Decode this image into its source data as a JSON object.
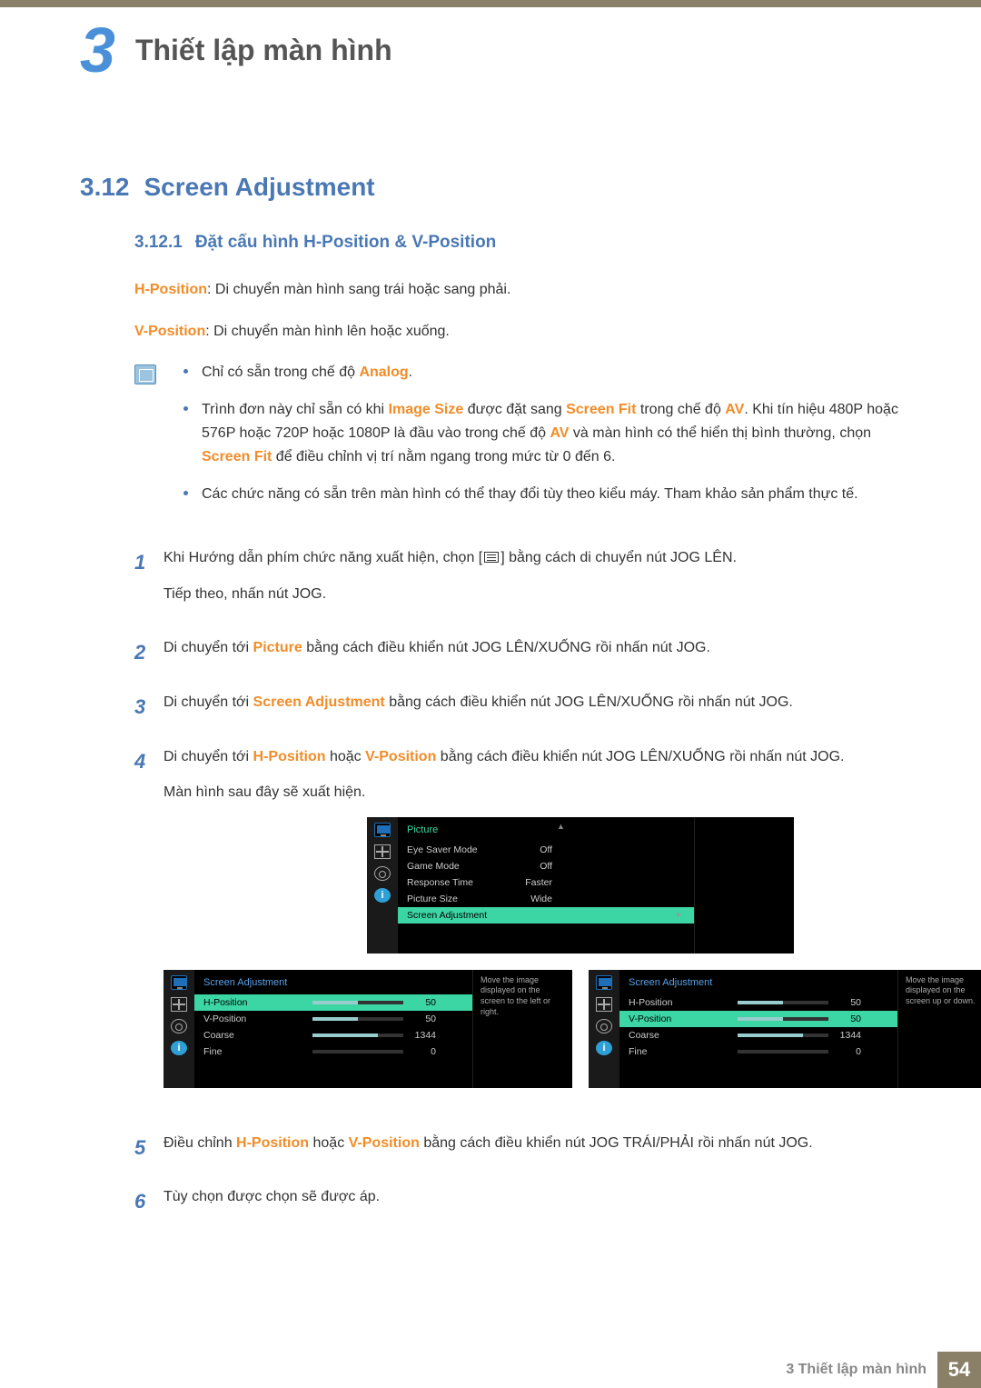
{
  "chapter": {
    "number": "3",
    "title": "Thiết lập màn hình"
  },
  "section": {
    "number": "3.12",
    "title": "Screen Adjustment"
  },
  "subsection": {
    "number": "3.12.1",
    "title": "Đặt cấu hình H-Position & V-Position"
  },
  "defs": {
    "hpos_label": "H-Position",
    "hpos_text": ": Di chuyển màn hình sang trái hoặc sang phải.",
    "vpos_label": "V-Position",
    "vpos_text": ": Di chuyển màn hình lên hoặc xuống."
  },
  "notes": {
    "b1_pre": "Chỉ có sẵn trong chế độ ",
    "b1_kw": "Analog",
    "b1_post": ".",
    "b2_pre": "Trình đơn này chỉ sẵn có khi ",
    "b2_kw1": "Image Size",
    "b2_mid1": " được đặt sang ",
    "b2_kw2": "Screen Fit",
    "b2_mid2": " trong chế độ ",
    "b2_kw3": "AV",
    "b2_mid3": ". Khi tín hiệu 480P hoặc 576P hoặc 720P hoặc 1080P là đầu vào trong chế độ ",
    "b2_kw4": "AV",
    "b2_mid4": " và màn hình có thể hiển thị bình thường, chọn ",
    "b2_kw5": "Screen Fit",
    "b2_post": " để điều chỉnh vị trí nằm ngang trong mức từ 0 đến 6.",
    "b3": "Các chức năng có sẵn trên màn hình có thể thay đổi tùy theo kiểu máy. Tham khảo sản phẩm thực tế."
  },
  "steps": {
    "s1a": "Khi Hướng dẫn phím chức năng xuất hiện, chọn [",
    "s1b": "] bằng cách di chuyển nút JOG LÊN.",
    "s1c": "Tiếp theo, nhấn nút JOG.",
    "s2_pre": "Di chuyển tới ",
    "s2_kw": "Picture",
    "s2_post": " bằng cách điều khiển nút JOG LÊN/XUỐNG rồi nhấn nút JOG.",
    "s3_pre": "Di chuyển tới ",
    "s3_kw": "Screen Adjustment",
    "s3_post": " bằng cách điều khiển nút JOG LÊN/XUỐNG rồi nhấn nút JOG.",
    "s4_pre": "Di chuyển tới ",
    "s4_kw1": "H-Position",
    "s4_mid": " hoặc ",
    "s4_kw2": "V-Position",
    "s4_post": " bằng cách điều khiển nút JOG LÊN/XUỐNG rồi nhấn nút JOG.",
    "s4b": "Màn hình sau đây sẽ xuất hiện.",
    "s5_pre": "Điều chỉnh ",
    "s5_kw1": "H-Position",
    "s5_mid": " hoặc ",
    "s5_kw2": "V-Position",
    "s5_post": " bằng cách điều khiển nút JOG TRÁI/PHẢI rồi nhấn nút JOG.",
    "s6": "Tùy chọn được chọn sẽ được áp."
  },
  "osd1": {
    "title": "Picture",
    "rows": [
      {
        "label": "Eye Saver Mode",
        "value": "Off"
      },
      {
        "label": "Game Mode",
        "value": "Off"
      },
      {
        "label": "Response Time",
        "value": "Faster"
      },
      {
        "label": "Picture Size",
        "value": "Wide"
      }
    ],
    "hl": "Screen Adjustment"
  },
  "osd2": {
    "title": "Screen Adjustment",
    "rows": [
      {
        "label": "H-Position",
        "value": "50",
        "fill": "50%",
        "hl": true
      },
      {
        "label": "V-Position",
        "value": "50",
        "fill": "50%"
      },
      {
        "label": "Coarse",
        "value": "1344",
        "fill": "72%"
      },
      {
        "label": "Fine",
        "value": "0",
        "fill": "0%"
      }
    ],
    "help": "Move the image displayed on the screen to the left or right."
  },
  "osd3": {
    "title": "Screen Adjustment",
    "rows": [
      {
        "label": "H-Position",
        "value": "50",
        "fill": "50%"
      },
      {
        "label": "V-Position",
        "value": "50",
        "fill": "50%",
        "hl": true
      },
      {
        "label": "Coarse",
        "value": "1344",
        "fill": "72%"
      },
      {
        "label": "Fine",
        "value": "0",
        "fill": "0%"
      }
    ],
    "help": "Move the image displayed on the screen up or down."
  },
  "footer": {
    "chapter_label": "3 Thiết lập màn hình",
    "page": "54"
  }
}
